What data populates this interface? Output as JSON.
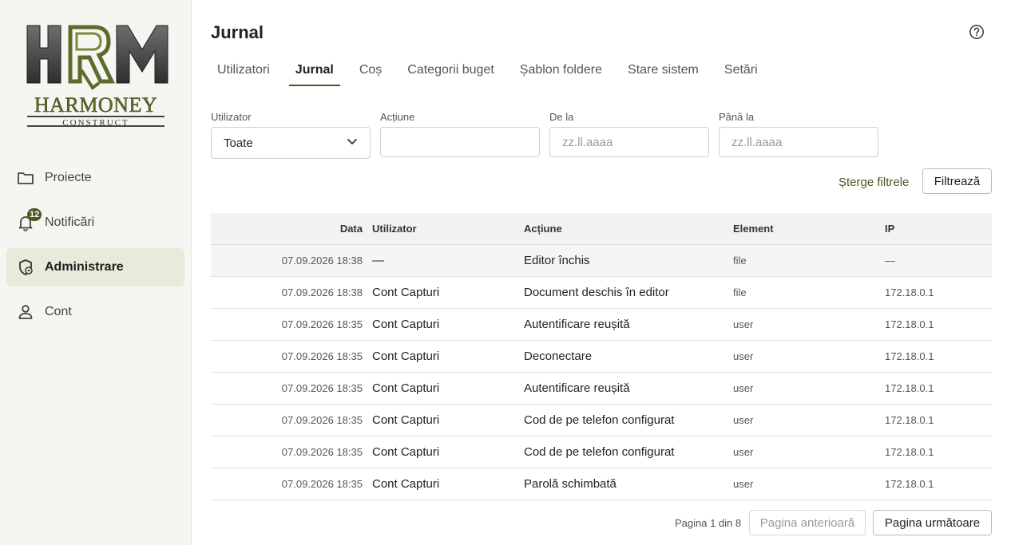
{
  "brand": {
    "logo_text": "HRM",
    "name": "HARMONEY",
    "sub": "CONSTRUCT",
    "accent": "#4a5a22"
  },
  "sidebar": {
    "items": [
      {
        "label": "Proiecte",
        "icon": "folder-icon"
      },
      {
        "label": "Notificări",
        "icon": "bell-icon",
        "badge": "12"
      },
      {
        "label": "Administrare",
        "icon": "admin-shield-icon",
        "active": true
      },
      {
        "label": "Cont",
        "icon": "user-icon"
      }
    ]
  },
  "header": {
    "title": "Jurnal",
    "help_icon": "help-icon"
  },
  "tabs": [
    {
      "label": "Utilizatori"
    },
    {
      "label": "Jurnal",
      "active": true
    },
    {
      "label": "Coș"
    },
    {
      "label": "Categorii buget"
    },
    {
      "label": "Șablon foldere"
    },
    {
      "label": "Stare sistem"
    },
    {
      "label": "Setări"
    }
  ],
  "filters": {
    "user": {
      "label": "Utilizator",
      "value": "Toate"
    },
    "action": {
      "label": "Acțiune",
      "value": ""
    },
    "from": {
      "label": "De la",
      "placeholder": "zz.ll.aaaa"
    },
    "to": {
      "label": "Până la",
      "placeholder": "zz.ll.aaaa"
    },
    "clear_label": "Șterge filtrele",
    "apply_label": "Filtrează"
  },
  "table": {
    "headers": {
      "date": "Data",
      "user": "Utilizator",
      "action": "Acțiune",
      "element": "Element",
      "ip": "IP"
    },
    "rows": [
      {
        "date": "07.09.2026 18:38",
        "user": "—",
        "action": "Editor închis",
        "element": "file",
        "ip": "—"
      },
      {
        "date": "07.09.2026 18:38",
        "user": "Cont Capturi",
        "action": "Document deschis în editor",
        "element": "file",
        "ip": "172.18.0.1"
      },
      {
        "date": "07.09.2026 18:35",
        "user": "Cont Capturi",
        "action": "Autentificare reușită",
        "element": "user",
        "ip": "172.18.0.1"
      },
      {
        "date": "07.09.2026 18:35",
        "user": "Cont Capturi",
        "action": "Deconectare",
        "element": "user",
        "ip": "172.18.0.1"
      },
      {
        "date": "07.09.2026 18:35",
        "user": "Cont Capturi",
        "action": "Autentificare reușită",
        "element": "user",
        "ip": "172.18.0.1"
      },
      {
        "date": "07.09.2026 18:35",
        "user": "Cont Capturi",
        "action": "Cod de pe telefon configurat",
        "element": "user",
        "ip": "172.18.0.1"
      },
      {
        "date": "07.09.2026 18:35",
        "user": "Cont Capturi",
        "action": "Cod de pe telefon configurat",
        "element": "user",
        "ip": "172.18.0.1"
      },
      {
        "date": "07.09.2026 18:35",
        "user": "Cont Capturi",
        "action": "Parolă schimbată",
        "element": "user",
        "ip": "172.18.0.1"
      }
    ]
  },
  "pagination": {
    "info": "Pagina 1 din 8",
    "prev_label": "Pagina anterioară",
    "next_label": "Pagina următoare"
  }
}
